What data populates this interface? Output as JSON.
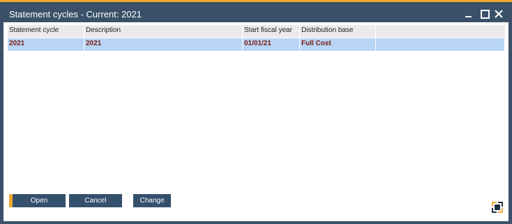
{
  "window": {
    "title": "Statement cycles -  Current: 2021",
    "controls": {
      "minimize": "minimize-icon",
      "maximize": "maximize-icon",
      "close": "close-icon"
    },
    "accent_color": "#f0a830",
    "frame_color": "#3a5169"
  },
  "grid": {
    "columns": [
      "Statement cycle",
      "Description",
      "Start fiscal year",
      "Distribution base"
    ],
    "rows": [
      {
        "statement_cycle": "2021",
        "description": "2021",
        "start_fiscal_year": "01/01/21",
        "distribution_base": "Full Cost"
      }
    ],
    "selected_row_color": "#b8d5f6",
    "row_text_color": "#7a1b12"
  },
  "buttons": {
    "open": "Open",
    "cancel": "Cancel",
    "change": "Change"
  }
}
